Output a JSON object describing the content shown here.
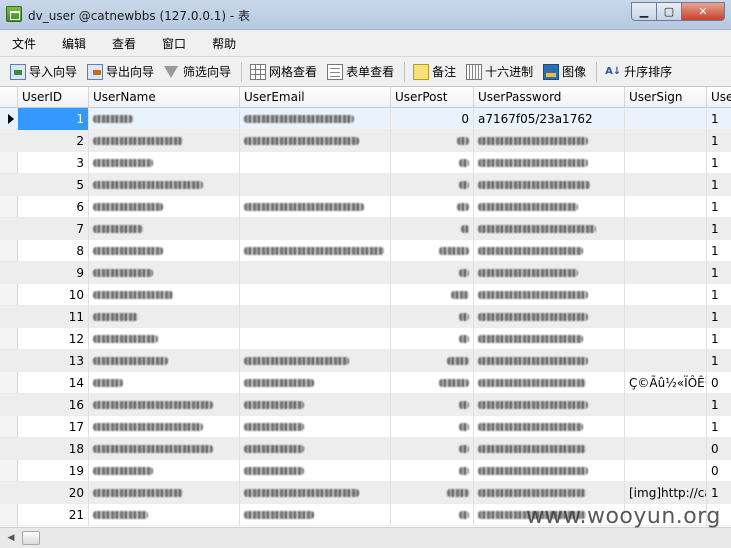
{
  "window": {
    "title": "dv_user @catnewbbs (127.0.0.1) - 表"
  },
  "menu": [
    "文件",
    "编辑",
    "查看",
    "窗口",
    "帮助"
  ],
  "toolbar": {
    "import": "导入向导",
    "export": "导出向导",
    "filter": "筛选向导",
    "grid_view": "网格查看",
    "form_view": "表单查看",
    "memo": "备注",
    "hex": "十六进制",
    "image": "图像",
    "sort": "升序排序"
  },
  "columns": [
    "UserID",
    "UserName",
    "UserEmail",
    "UserPost",
    "UserPassword",
    "UserSign",
    "Use"
  ],
  "rows": [
    {
      "id": "1",
      "name": "",
      "email": "",
      "post": "0",
      "password": "a7167f05/23a1762",
      "sign": "",
      "flag": "1",
      "selected": true
    },
    {
      "id": "2",
      "name": "",
      "email": "",
      "post": "",
      "password": "",
      "sign": "",
      "flag": "1"
    },
    {
      "id": "3",
      "name": "",
      "email": "",
      "post": "",
      "password": "",
      "sign": "",
      "flag": "1"
    },
    {
      "id": "5",
      "name": "",
      "email": "",
      "post": "",
      "password": "",
      "sign": "",
      "flag": "1"
    },
    {
      "id": "6",
      "name": "",
      "email": "",
      "post": "",
      "password": "",
      "sign": "",
      "flag": "1"
    },
    {
      "id": "7",
      "name": "",
      "email": "",
      "post": "",
      "password": "",
      "sign": "",
      "flag": "1"
    },
    {
      "id": "8",
      "name": "",
      "email": "",
      "post": "",
      "password": "",
      "sign": "",
      "flag": "1"
    },
    {
      "id": "9",
      "name": "",
      "email": "",
      "post": "",
      "password": "",
      "sign": "",
      "flag": "1"
    },
    {
      "id": "10",
      "name": "",
      "email": "",
      "post": "",
      "password": "",
      "sign": "",
      "flag": "1"
    },
    {
      "id": "11",
      "name": "",
      "email": "",
      "post": "",
      "password": "",
      "sign": "",
      "flag": "1"
    },
    {
      "id": "12",
      "name": "",
      "email": "",
      "post": "",
      "password": "",
      "sign": "",
      "flag": "1"
    },
    {
      "id": "13",
      "name": "",
      "email": "",
      "post": "",
      "password": "",
      "sign": "",
      "flag": "1"
    },
    {
      "id": "14",
      "name": "",
      "email": "",
      "post": "",
      "password": "",
      "sign": "Ç©Ãû½«ÏÔÊ¾",
      "flag": "0"
    },
    {
      "id": "16",
      "name": "",
      "email": "",
      "post": "",
      "password": "",
      "sign": "",
      "flag": "1"
    },
    {
      "id": "17",
      "name": "",
      "email": "",
      "post": "",
      "password": "",
      "sign": "",
      "flag": "1"
    },
    {
      "id": "18",
      "name": "",
      "email": "",
      "post": "",
      "password": "",
      "sign": "",
      "flag": "0"
    },
    {
      "id": "19",
      "name": "",
      "email": "",
      "post": "",
      "password": "",
      "sign": "",
      "flag": "0"
    },
    {
      "id": "20",
      "name": "",
      "email": "",
      "post": "",
      "password": "",
      "sign": "[img]http://ca",
      "flag": "1"
    },
    {
      "id": "21",
      "name": "",
      "email": "",
      "post": "",
      "password": "",
      "sign": "",
      "flag": ""
    }
  ],
  "watermark": "www.wooyun.org"
}
